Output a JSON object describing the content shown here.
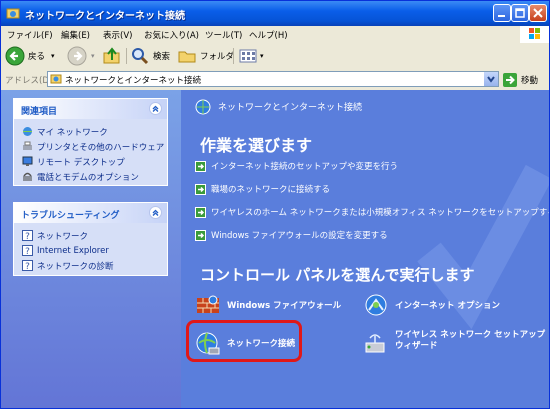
{
  "window": {
    "title": "ネットワークとインターネット接続"
  },
  "menu": {
    "items": [
      "ファイル(F)",
      "編集(E)",
      "表示(V)",
      "お気に入り(A)",
      "ツール(T)",
      "ヘルプ(H)"
    ]
  },
  "toolbar": {
    "back_label": "戻る",
    "search_label": "検索",
    "folders_label": "フォルダ"
  },
  "address": {
    "label": "アドレス(D)",
    "value": "ネットワークとインターネット接続",
    "go_label": "移動"
  },
  "sidebar": {
    "related": {
      "title": "関連項目",
      "items": [
        "マイ ネットワーク",
        "プリンタとその他のハードウェア",
        "リモート デスクトップ",
        "電話とモデムのオプション"
      ]
    },
    "troubleshoot": {
      "title": "トラブルシューティング",
      "items": [
        "ネットワーク",
        "Internet Explorer",
        "ネットワークの診断"
      ]
    }
  },
  "main": {
    "header": "ネットワークとインターネット接続",
    "task_heading": "作業を選びます",
    "tasks": [
      "インターネット接続のセットアップや変更を行う",
      "職場のネットワークに接続する",
      "ワイヤレスのホーム ネットワークまたは小規模オフィス ネットワークをセットアップする",
      "Windows ファイアウォールの設定を変更する"
    ],
    "cp_heading": "コントロール パネルを選んで実行します",
    "cp_items": [
      "Windows ファイアウォール",
      "インターネット オプション",
      "ネットワーク接続",
      "ワイヤレス ネットワーク セットアップ",
      "ウィザード"
    ]
  },
  "colors": {
    "title_bar": "#0a5ee9",
    "main_bg": "#5a7edc",
    "highlight": "#e01818"
  }
}
